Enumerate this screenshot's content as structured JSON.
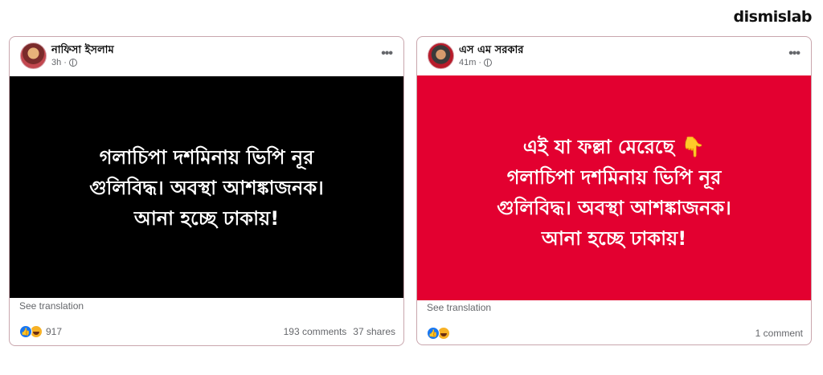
{
  "brand": {
    "logo_text": "dismislab"
  },
  "posts": [
    {
      "author": "নাফিসা ইসলাম",
      "time": "3h",
      "privacy_icon": "globe-icon",
      "more_icon": "•••",
      "image_text": "গলাচিপা দশমিনায় ভিপি নূর\nগুলিবিদ্ধ। অবস্থা আশঙ্কাজনক।\nআনা হচ্ছে ঢাকায়!",
      "image_bg": "#000000",
      "see_translation": "See translation",
      "like_glyph": "👍",
      "reaction_count": "917",
      "comments": "193 comments",
      "shares": "37 shares"
    },
    {
      "author": "এস এম সরকার",
      "time": "41m",
      "privacy_icon": "globe-icon",
      "more_icon": "•••",
      "image_text": "এই যা ফল্লা মেরেছে 👇\nগলাচিপা দশমিনায় ভিপি নূর\nগুলিবিদ্ধ। অবস্থা আশঙ্কাজনক।\nআনা হচ্ছে ঢাকায়!",
      "image_bg": "#e30030",
      "see_translation": "See translation",
      "like_glyph": "👍",
      "reaction_count": "",
      "comments": "1 comment",
      "shares": ""
    }
  ]
}
